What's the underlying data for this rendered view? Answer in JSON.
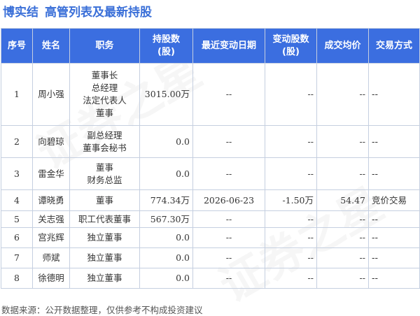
{
  "title": {
    "company": "博实结",
    "section": "高管列表及最新持股"
  },
  "watermark": "证券之星",
  "headers": [
    "序号",
    "姓名",
    "职务",
    "持股数(股)",
    "最近变动日期",
    "变动股数(股)",
    "成交均价",
    "交易方式"
  ],
  "rows": [
    {
      "no": "1",
      "name": "周小强",
      "positions": [
        "董事长",
        "总经理",
        "法定代表人",
        "董事"
      ],
      "shares": "3015.00万",
      "date": "--",
      "change": "--",
      "price": "--",
      "method": "--"
    },
    {
      "no": "2",
      "name": "向碧琼",
      "positions": [
        "副总经理",
        "董事会秘书"
      ],
      "shares": "0.0",
      "date": "--",
      "change": "--",
      "price": "--",
      "method": "--"
    },
    {
      "no": "3",
      "name": "雷金华",
      "positions": [
        "董事",
        "财务总监"
      ],
      "shares": "0.0",
      "date": "--",
      "change": "--",
      "price": "--",
      "method": "--"
    },
    {
      "no": "4",
      "name": "谭晓勇",
      "positions": [
        "董事"
      ],
      "shares": "774.34万",
      "date": "2026-06-23",
      "change": "-1.50万",
      "price": "54.47",
      "method": "竞价交易"
    },
    {
      "no": "5",
      "name": "关志强",
      "positions": [
        "职工代表董事"
      ],
      "shares": "567.30万",
      "date": "--",
      "change": "--",
      "price": "--",
      "method": "--"
    },
    {
      "no": "6",
      "name": "宫兆辉",
      "positions": [
        "独立董事"
      ],
      "shares": "0.0",
      "date": "--",
      "change": "--",
      "price": "--",
      "method": "--"
    },
    {
      "no": "7",
      "name": "师斌",
      "positions": [
        "独立董事"
      ],
      "shares": "0.0",
      "date": "--",
      "change": "--",
      "price": "--",
      "method": "--"
    },
    {
      "no": "8",
      "name": "徐德明",
      "positions": [
        "独立董事"
      ],
      "shares": "0.0",
      "date": "--",
      "change": "--",
      "price": "--",
      "method": "--"
    }
  ],
  "footer": "数据来源：公开数据整理，仅供参考不构成投资建议",
  "colors": {
    "header_bg": "#3b6ee0",
    "title": "#3a6fd8",
    "border": "#c5cfe0",
    "negative": "#1f9e3a",
    "price": "#1f9e3a"
  }
}
